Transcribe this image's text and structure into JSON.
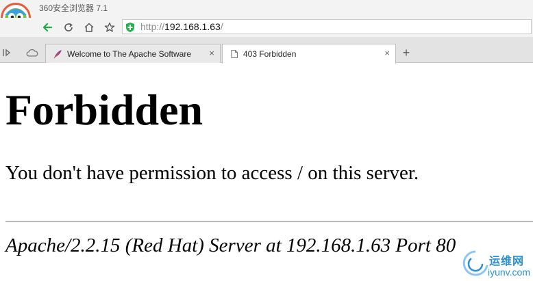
{
  "browser": {
    "app_title": "360安全浏览器 7.1",
    "address": {
      "scheme": "http://",
      "host": "192.168.1.63",
      "rest": "/"
    },
    "tabs": [
      {
        "label": "Welcome to The Apache Software",
        "active": false,
        "close": "×"
      },
      {
        "label": "403 Forbidden",
        "active": true,
        "close": "×"
      }
    ],
    "new_tab": "+",
    "colors": {
      "back_arrow": "#22a845",
      "secure_shield": "#22b14c",
      "tab_feather": "#8e3b9e"
    },
    "icons": [
      "back-arrow-icon",
      "reload-icon",
      "home-icon",
      "star-icon",
      "shield-icon",
      "sidebar-toggle-icon",
      "cloud-icon",
      "feather-icon",
      "page-icon"
    ]
  },
  "page": {
    "heading": "Forbidden",
    "message": "You don't have permission to access / on this server.",
    "signature": "Apache/2.2.15 (Red Hat) Server at 192.168.1.63 Port 80"
  },
  "watermark": {
    "line1": "运维网",
    "line2": "iyunv.com"
  }
}
